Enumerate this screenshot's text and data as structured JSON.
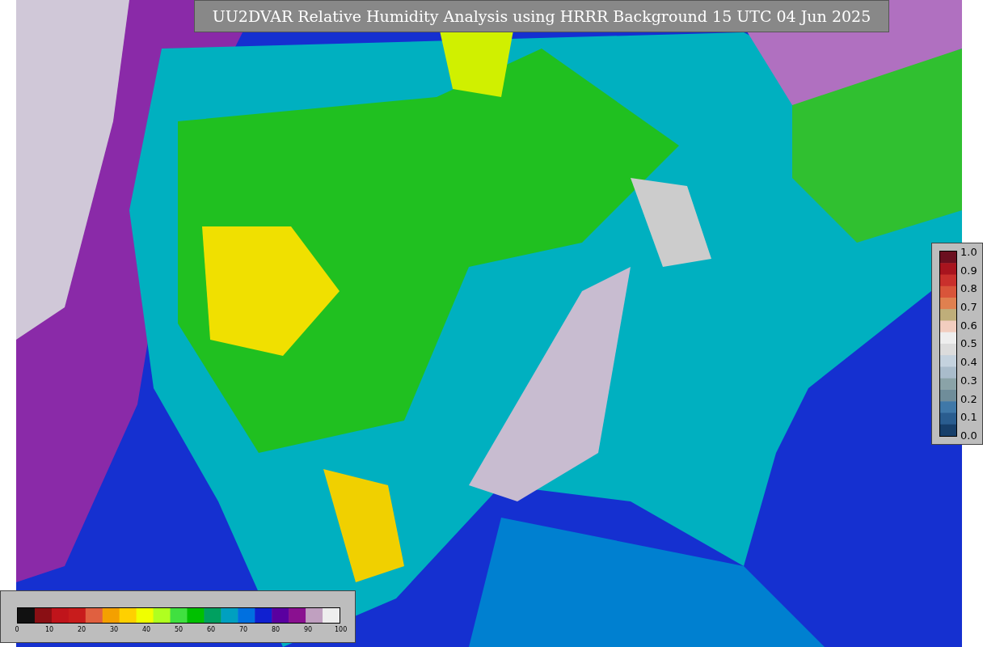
{
  "title": "UU2DVAR Relative Humidity Analysis using HRRR Background 15 UTC 04 Jun 2025",
  "vertical_colorbar": {
    "ticks": [
      "1.0",
      "0.9",
      "0.8",
      "0.7",
      "0.6",
      "0.5",
      "0.4",
      "0.3",
      "0.2",
      "0.1",
      "0.0"
    ]
  },
  "horizontal_colorbar": {
    "ticks": [
      "0",
      "10",
      "20",
      "30",
      "40",
      "50",
      "60",
      "70",
      "80",
      "90",
      "100"
    ]
  }
}
